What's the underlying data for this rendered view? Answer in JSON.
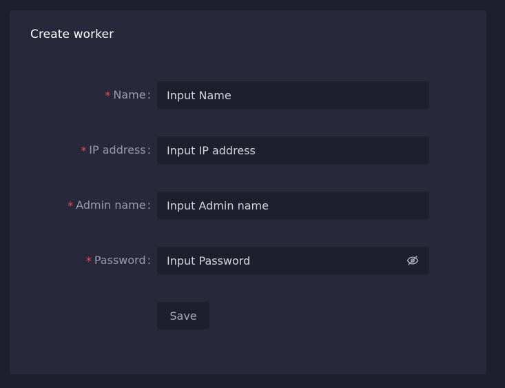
{
  "card": {
    "title": "Create worker"
  },
  "form": {
    "required_mark": "*",
    "colon": ":",
    "fields": [
      {
        "label": "Name",
        "placeholder": "Input Name",
        "value": ""
      },
      {
        "label": "IP address",
        "placeholder": "Input IP address",
        "value": ""
      },
      {
        "label": "Admin name",
        "placeholder": "Input Admin name",
        "value": ""
      },
      {
        "label": "Password",
        "placeholder": "Input Password",
        "value": "",
        "icon": "eye-off-icon"
      }
    ],
    "save_label": "Save"
  },
  "colors": {
    "background": "#1e1f2e",
    "card": "#272839",
    "input": "#1e1e2d",
    "required": "#f2485a",
    "label": "#9a9bb0"
  }
}
